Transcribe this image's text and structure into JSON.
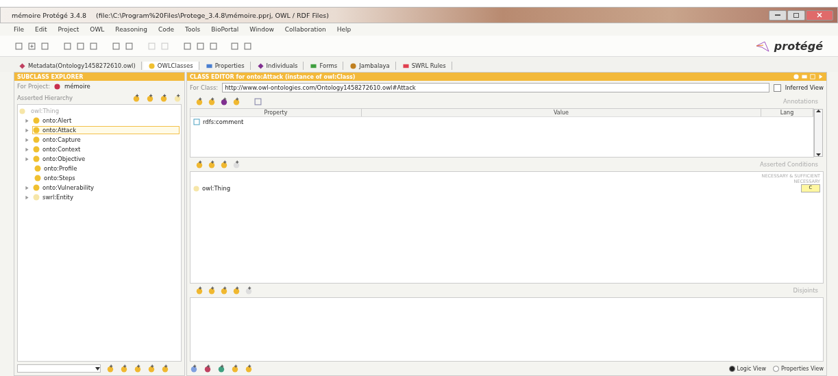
{
  "window": {
    "title": "mémoire  Protégé 3.4.8",
    "path": "(file:\\C:\\Program%20Files\\Protege_3.4.8\\mémoire.pprj, OWL / RDF Files)"
  },
  "menu": [
    "File",
    "Edit",
    "Project",
    "OWL",
    "Reasoning",
    "Code",
    "Tools",
    "BioPortal",
    "Window",
    "Collaboration",
    "Help"
  ],
  "logo": "protégé",
  "tabs": [
    {
      "label": "Metadata(Ontology1458272610.owl)",
      "kind": "metadata",
      "selected": false
    },
    {
      "label": "OWLClasses",
      "kind": "classes",
      "selected": true
    },
    {
      "label": "Properties",
      "kind": "properties",
      "selected": false
    },
    {
      "label": "Individuals",
      "kind": "individuals",
      "selected": false
    },
    {
      "label": "Forms",
      "kind": "forms",
      "selected": false
    },
    {
      "label": "Jambalaya",
      "kind": "jambalaya",
      "selected": false
    },
    {
      "label": "SWRL Rules",
      "kind": "swrl",
      "selected": false
    }
  ],
  "subclass_explorer": {
    "title": "SUBCLASS EXPLORER",
    "project_label": "For Project:",
    "project": "mémoire",
    "hierarchy_label": "Asserted Hierarchy",
    "tree": [
      {
        "label": "owl:Thing",
        "children": [
          {
            "label": "onto:Alert",
            "leaf": false,
            "selected": false
          },
          {
            "label": "onto:Attack",
            "leaf": false,
            "selected": true
          },
          {
            "label": "onto:Capture",
            "leaf": false,
            "selected": false
          },
          {
            "label": "onto:Context",
            "leaf": false,
            "selected": false
          },
          {
            "label": "onto:Objective",
            "leaf": false,
            "selected": false
          },
          {
            "label": "onto:Profile",
            "leaf": true,
            "selected": false
          },
          {
            "label": "onto:Steps",
            "leaf": true,
            "selected": false
          },
          {
            "label": "onto:Vulnerability",
            "leaf": false,
            "selected": false
          },
          {
            "label": "swrl:Entity",
            "leaf": false,
            "selected": false
          }
        ]
      }
    ]
  },
  "class_editor": {
    "title": "CLASS EDITOR for onto:Attack   (instance of owl:Class)",
    "for_class_label": "For Class:",
    "for_class": "http://www.owl-ontologies.com/Ontology1458272610.owl#Attack",
    "inferred_view": {
      "label": "Inferred View",
      "checked": false
    },
    "annotations_label": "Annotations",
    "columns": [
      "Property",
      "Value",
      "Lang"
    ],
    "rows": [
      {
        "property": "rdfs:comment"
      }
    ],
    "conditions_label": "Asserted Conditions",
    "necessary_sufficient": "NECESSARY & SUFFICIENT",
    "necessary": "NECESSARY",
    "conditions": [
      {
        "label": "owl:Thing",
        "marker": "C"
      }
    ],
    "disjoints_label": "Disjoints",
    "views": [
      {
        "label": "Logic View",
        "selected": true
      },
      {
        "label": "Properties View",
        "selected": false
      }
    ]
  }
}
